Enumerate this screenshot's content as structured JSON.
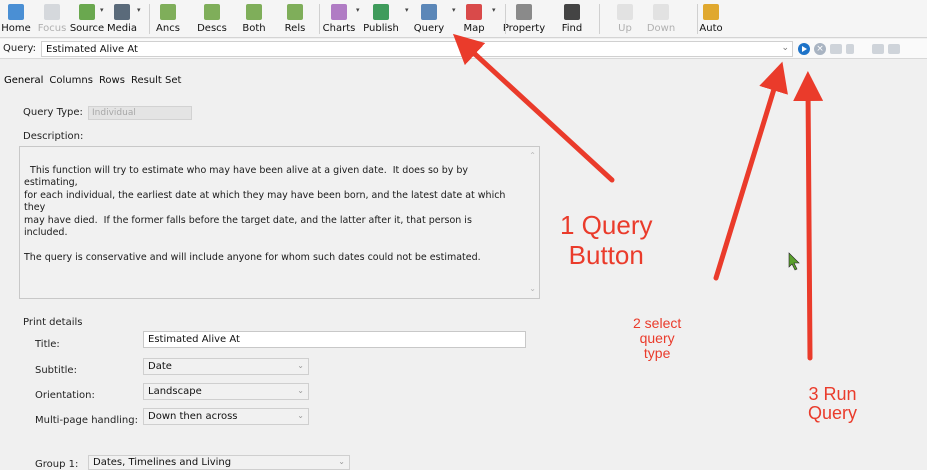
{
  "toolbar": {
    "buttons": [
      {
        "label": "Home",
        "icon": "home-icon",
        "color": "#4a8fd4",
        "disabled": false
      },
      {
        "label": "Focus",
        "icon": "focus-icon",
        "color": "#9aa4ae",
        "disabled": true
      },
      {
        "label": "Source",
        "icon": "source-icon",
        "color": "#6aa84f",
        "disabled": false
      },
      {
        "label": "Media",
        "icon": "media-icon",
        "color": "#5a6a7a",
        "disabled": false
      },
      {
        "label": "Ancs",
        "icon": "ancestors-icon",
        "color": "#7fae5a",
        "disabled": false
      },
      {
        "label": "Descs",
        "icon": "descendants-icon",
        "color": "#7fae5a",
        "disabled": false
      },
      {
        "label": "Both",
        "icon": "both-icon",
        "color": "#7fae5a",
        "disabled": false
      },
      {
        "label": "Rels",
        "icon": "relatives-icon",
        "color": "#7fae5a",
        "disabled": false
      },
      {
        "label": "Charts",
        "icon": "charts-icon",
        "color": "#b07cc4",
        "disabled": false
      },
      {
        "label": "Publish",
        "icon": "publish-icon",
        "color": "#3f9b5b",
        "disabled": false
      },
      {
        "label": "Query",
        "icon": "query-icon",
        "color": "#5b87b8",
        "disabled": false
      },
      {
        "label": "Map",
        "icon": "map-icon",
        "color": "#d94a4a",
        "disabled": false
      },
      {
        "label": "Property",
        "icon": "property-icon",
        "color": "#8a8a8a",
        "disabled": false
      },
      {
        "label": "Find",
        "icon": "find-icon",
        "color": "#444444",
        "disabled": false
      },
      {
        "label": "Up",
        "icon": "up-icon",
        "color": "#c0c0c0",
        "disabled": true
      },
      {
        "label": "Down",
        "icon": "down-icon",
        "color": "#c0c0c0",
        "disabled": true
      },
      {
        "label": "Auto",
        "icon": "auto-icon",
        "color": "#e0a82e",
        "disabled": false
      }
    ]
  },
  "querybar": {
    "label": "Query:",
    "value": "Estimated Alive At"
  },
  "tabs": [
    "General",
    "Columns",
    "Rows",
    "Result Set"
  ],
  "general": {
    "query_type_label": "Query Type:",
    "query_type_value": "Individual",
    "description_label": "Description:",
    "description": "This function will try to estimate who may have been alive at a given date.  It does so by by estimating,\nfor each individual, the earliest date at which they may have been born, and the latest date at which they\nmay have died.  If the former falls before the target date, and the latter after it, that person is included.\n\nThe query is conservative and will include anyone for whom such dates could not be estimated."
  },
  "print_details": {
    "heading": "Print details",
    "title_label": "Title:",
    "title_value": "Estimated Alive At",
    "subtitle_label": "Subtitle:",
    "subtitle_value": "Date",
    "orientation_label": "Orientation:",
    "orientation_value": "Landscape",
    "multipage_label": "Multi-page handling:",
    "multipage_value": "Down then across"
  },
  "group": {
    "label": "Group 1:",
    "value": "Dates, Timelines and Living"
  },
  "annotations": {
    "query_button_1": "1 Query",
    "query_button_2": "Button",
    "select_1": "2 select",
    "select_2": "query",
    "select_3": "type",
    "run_1": "3 Run",
    "run_2": "Query",
    "color": "#ea3b2b"
  }
}
